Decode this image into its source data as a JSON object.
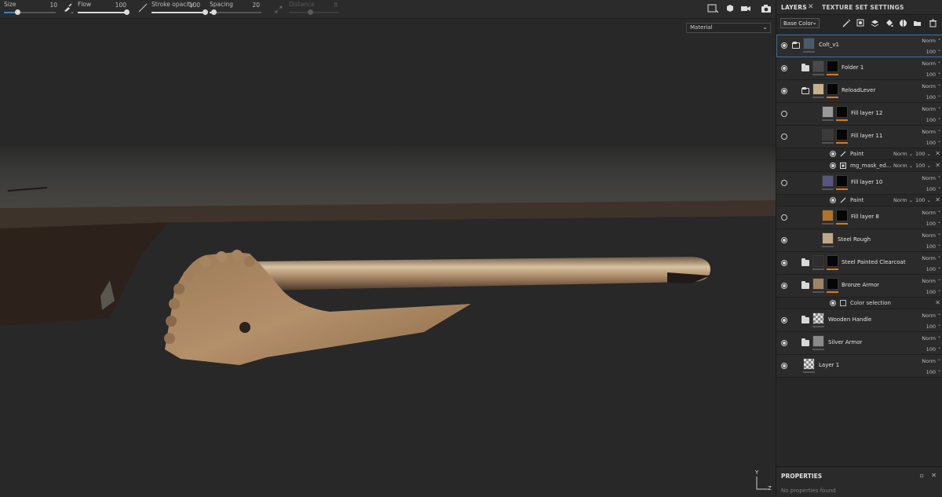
{
  "toolbar": {
    "size": {
      "label": "Size",
      "value": "10",
      "fraction": 0.26
    },
    "flow": {
      "label": "Flow",
      "value": "100",
      "fraction": 1.0
    },
    "stroke_opacity": {
      "label": "Stroke opacity",
      "value": "100",
      "fraction": 1.0
    },
    "spacing": {
      "label": "Spacing",
      "value": "20",
      "fraction": 0.05
    },
    "distance": {
      "label": "Distance",
      "value": "8",
      "fraction": 0.4
    }
  },
  "viewport": {
    "material_mode": "Material",
    "gizmo": {
      "y": "Y",
      "z": "Z"
    }
  },
  "panel": {
    "tabs": [
      {
        "label": "LAYERS",
        "active": true
      },
      {
        "label": "TEXTURE SET SETTINGS",
        "active": false
      }
    ],
    "channel": "Base Color"
  },
  "layers": [
    {
      "name": "Colt_v1",
      "blend": "Norm",
      "opacity": "100",
      "selected": true,
      "folder": "open",
      "eye": true,
      "thumb": "#4a5a6a",
      "mask": false
    },
    {
      "name": "Folder 1",
      "blend": "Norm",
      "opacity": "100",
      "folder": "closed",
      "eye": true,
      "thumb": "#4a4a4a",
      "mask": true
    },
    {
      "name": "ReloadLever",
      "blend": "Norm",
      "opacity": "100",
      "folder": "open",
      "eye": true,
      "thumb": "#c8b08e",
      "mask": true
    },
    {
      "name": "Fill layer 12",
      "blend": "Norm",
      "opacity": "100",
      "eye": false,
      "thumb": "#9a9a9a",
      "mask": true
    },
    {
      "name": "Fill layer 11",
      "blend": "Norm",
      "opacity": "100",
      "eye": false,
      "thumb": "#3a3a3a",
      "mask": true
    },
    {
      "name": "Fill layer 10",
      "blend": "Norm",
      "opacity": "100",
      "eye": false,
      "thumb": "#58567e",
      "mask": true
    },
    {
      "name": "Fill layer 8",
      "blend": "Norm",
      "opacity": "100",
      "eye": false,
      "thumb": "#b0732a",
      "mask": true
    },
    {
      "name": "Steel Rough",
      "blend": "Norm",
      "opacity": "100",
      "eye": true,
      "thumb": "#c0a888",
      "mask": false
    },
    {
      "name": "Steel Painted Clearcoat",
      "blend": "Norm",
      "opacity": "100",
      "folder": "closed",
      "eye": true,
      "thumb": "#2e2e2e",
      "mask": true
    },
    {
      "name": "Bronze Armor",
      "blend": "Norm",
      "opacity": "100",
      "folder": "closed",
      "eye": true,
      "thumb": "#9e8468",
      "mask": true
    },
    {
      "name": "Wooden Handle",
      "blend": "Norm",
      "opacity": "100",
      "folder": "closed",
      "eye": true,
      "thumb": "checker",
      "mask": false
    },
    {
      "name": "Silver Armor",
      "blend": "Norm",
      "opacity": "100",
      "folder": "closed",
      "eye": true,
      "thumb": "#8a8a8a",
      "mask": false
    },
    {
      "name": "Layer 1",
      "blend": "Norm",
      "opacity": "100",
      "eye": true,
      "thumb": "checker",
      "mask": false
    }
  ],
  "effects": {
    "fill11_paint": {
      "name": "Paint",
      "blend": "Norm",
      "opacity": "100"
    },
    "fill11_mask": {
      "name": "mg_mask_ed...",
      "blend": "Norm",
      "opacity": "100"
    },
    "fill10_paint": {
      "name": "Paint",
      "blend": "Norm",
      "opacity": "100"
    },
    "bronze_colorsel": {
      "name": "Color selection"
    }
  },
  "properties": {
    "title": "PROPERTIES",
    "message": "No properties found"
  },
  "colors": {
    "accent": "#3b82c4",
    "mask_bar": "#d97a1e",
    "selection": "#3d6fa6"
  }
}
